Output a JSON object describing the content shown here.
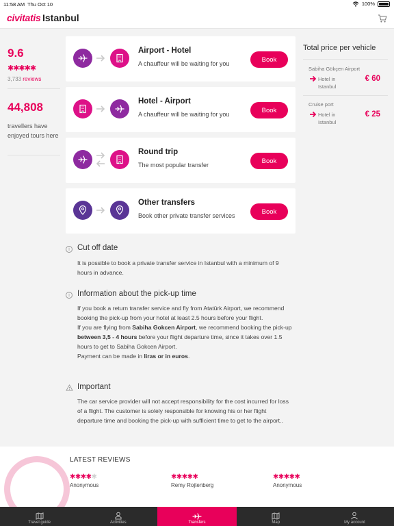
{
  "status_bar": {
    "time": "11:58 AM",
    "date": "Thu Oct 10",
    "battery": "100%"
  },
  "header": {
    "logo": "civitatis",
    "city": "Istanbul",
    "cart_icon": "cart-icon"
  },
  "stats": {
    "rating": "9.6",
    "stars": "✱✱✱✱✱",
    "reviews_count": "3,733",
    "reviews_word": "reviews",
    "travellers": "44,808",
    "travellers_text": "travellers have enjoyed tours here"
  },
  "transfers": [
    {
      "title": "Airport - Hotel",
      "subtitle": "A chauffeur will be waiting for you",
      "book_label": "Book",
      "from_icon": "plane-icon",
      "to_icon": "hotel-icon"
    },
    {
      "title": "Hotel - Airport",
      "subtitle": "A chauffeur will be waiting for you",
      "book_label": "Book",
      "from_icon": "hotel-icon",
      "to_icon": "plane-icon"
    },
    {
      "title": "Round trip",
      "subtitle": "The most popular transfer",
      "book_label": "Book",
      "from_icon": "plane-icon",
      "to_icon": "hotel-icon"
    },
    {
      "title": "Other transfers",
      "subtitle": "Book other private transfer services",
      "book_label": "Book",
      "from_icon": "location-pin-icon",
      "to_icon": "location-pin-icon"
    }
  ],
  "price_panel": {
    "title": "Total price per vehicle",
    "routes": [
      {
        "from": "Sabiha Gökçen Airport",
        "to": "Hotel in Istanbul",
        "price": "€ 60"
      },
      {
        "from": "Cruise port",
        "to": "Hotel in Istanbul",
        "price": "€ 25"
      }
    ]
  },
  "info": {
    "cutoff": {
      "title": "Cut off date",
      "body": "It is possible to book a private transfer service in Istanbul with a minimum of 9 hours in advance."
    },
    "pickup": {
      "title": "Information about the pick-up time",
      "p1": "If you book a return transfer service and fly from Atatürk Airport, we recommend booking the pick-up from your hotel at least 2.5 hours before your flight.",
      "p2_a": "If you are flying from ",
      "p2_b": "Sabiha Gokcen Airport",
      "p2_c": ", we recommend booking the pick-up ",
      "p2_d": "between 3,5 - 4 hours",
      "p2_e": " before your flight departure time, since it takes over 1.5 hours to get to Sabiha Gokcen Airport.",
      "p3_a": "Payment can be made in ",
      "p3_b": "liras or in euros",
      "p3_c": "."
    },
    "important": {
      "title": "Important",
      "body": "The car service provider will not accept responsibility for the cost incurred for loss of a flight. The customer is solely responsible for knowing his or her flight departure time and booking the pick-up with sufficient time to get to the airport.."
    }
  },
  "latest_reviews": {
    "title": "LATEST REVIEWS",
    "items": [
      {
        "stars_full": "✱✱✱✱",
        "stars_empty": "✱",
        "rating_value": 4,
        "name": "Anonymous"
      },
      {
        "stars_full": "✱✱✱✱✱",
        "stars_empty": "",
        "rating_value": 5,
        "name": "Remy Rojtenberg"
      },
      {
        "stars_full": "✱✱✱✱✱",
        "stars_empty": "",
        "rating_value": 5,
        "name": "Anonymous"
      }
    ]
  },
  "tabs": [
    {
      "label": "Travel guide",
      "icon": "map-book-icon",
      "active": false
    },
    {
      "label": "Activities",
      "icon": "person-icon",
      "active": false
    },
    {
      "label": "Transfers",
      "icon": "transfer-plane-icon",
      "active": true
    },
    {
      "label": "Map",
      "icon": "map-icon",
      "active": false
    },
    {
      "label": "My account",
      "icon": "account-icon",
      "active": false
    }
  ],
  "colors": {
    "brand": "#e8005a",
    "purple": "#8e2aa0",
    "magenta": "#dd1188",
    "indigo": "#5a3596",
    "tabbar": "#2b2b2b"
  }
}
